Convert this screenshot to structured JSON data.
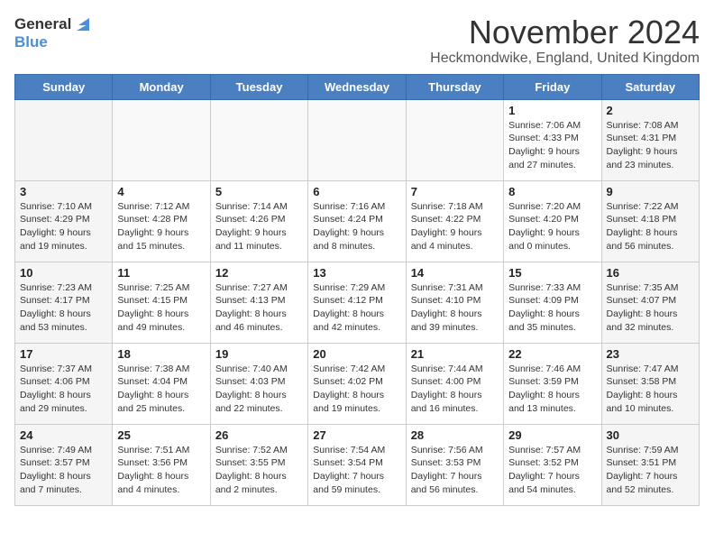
{
  "logo": {
    "line1": "General",
    "line2": "Blue"
  },
  "title": "November 2024",
  "location": "Heckmondwike, England, United Kingdom",
  "weekdays": [
    "Sunday",
    "Monday",
    "Tuesday",
    "Wednesday",
    "Thursday",
    "Friday",
    "Saturday"
  ],
  "weeks": [
    [
      {
        "day": "",
        "info": ""
      },
      {
        "day": "",
        "info": ""
      },
      {
        "day": "",
        "info": ""
      },
      {
        "day": "",
        "info": ""
      },
      {
        "day": "",
        "info": ""
      },
      {
        "day": "1",
        "info": "Sunrise: 7:06 AM\nSunset: 4:33 PM\nDaylight: 9 hours\nand 27 minutes."
      },
      {
        "day": "2",
        "info": "Sunrise: 7:08 AM\nSunset: 4:31 PM\nDaylight: 9 hours\nand 23 minutes."
      }
    ],
    [
      {
        "day": "3",
        "info": "Sunrise: 7:10 AM\nSunset: 4:29 PM\nDaylight: 9 hours\nand 19 minutes."
      },
      {
        "day": "4",
        "info": "Sunrise: 7:12 AM\nSunset: 4:28 PM\nDaylight: 9 hours\nand 15 minutes."
      },
      {
        "day": "5",
        "info": "Sunrise: 7:14 AM\nSunset: 4:26 PM\nDaylight: 9 hours\nand 11 minutes."
      },
      {
        "day": "6",
        "info": "Sunrise: 7:16 AM\nSunset: 4:24 PM\nDaylight: 9 hours\nand 8 minutes."
      },
      {
        "day": "7",
        "info": "Sunrise: 7:18 AM\nSunset: 4:22 PM\nDaylight: 9 hours\nand 4 minutes."
      },
      {
        "day": "8",
        "info": "Sunrise: 7:20 AM\nSunset: 4:20 PM\nDaylight: 9 hours\nand 0 minutes."
      },
      {
        "day": "9",
        "info": "Sunrise: 7:22 AM\nSunset: 4:18 PM\nDaylight: 8 hours\nand 56 minutes."
      }
    ],
    [
      {
        "day": "10",
        "info": "Sunrise: 7:23 AM\nSunset: 4:17 PM\nDaylight: 8 hours\nand 53 minutes."
      },
      {
        "day": "11",
        "info": "Sunrise: 7:25 AM\nSunset: 4:15 PM\nDaylight: 8 hours\nand 49 minutes."
      },
      {
        "day": "12",
        "info": "Sunrise: 7:27 AM\nSunset: 4:13 PM\nDaylight: 8 hours\nand 46 minutes."
      },
      {
        "day": "13",
        "info": "Sunrise: 7:29 AM\nSunset: 4:12 PM\nDaylight: 8 hours\nand 42 minutes."
      },
      {
        "day": "14",
        "info": "Sunrise: 7:31 AM\nSunset: 4:10 PM\nDaylight: 8 hours\nand 39 minutes."
      },
      {
        "day": "15",
        "info": "Sunrise: 7:33 AM\nSunset: 4:09 PM\nDaylight: 8 hours\nand 35 minutes."
      },
      {
        "day": "16",
        "info": "Sunrise: 7:35 AM\nSunset: 4:07 PM\nDaylight: 8 hours\nand 32 minutes."
      }
    ],
    [
      {
        "day": "17",
        "info": "Sunrise: 7:37 AM\nSunset: 4:06 PM\nDaylight: 8 hours\nand 29 minutes."
      },
      {
        "day": "18",
        "info": "Sunrise: 7:38 AM\nSunset: 4:04 PM\nDaylight: 8 hours\nand 25 minutes."
      },
      {
        "day": "19",
        "info": "Sunrise: 7:40 AM\nSunset: 4:03 PM\nDaylight: 8 hours\nand 22 minutes."
      },
      {
        "day": "20",
        "info": "Sunrise: 7:42 AM\nSunset: 4:02 PM\nDaylight: 8 hours\nand 19 minutes."
      },
      {
        "day": "21",
        "info": "Sunrise: 7:44 AM\nSunset: 4:00 PM\nDaylight: 8 hours\nand 16 minutes."
      },
      {
        "day": "22",
        "info": "Sunrise: 7:46 AM\nSunset: 3:59 PM\nDaylight: 8 hours\nand 13 minutes."
      },
      {
        "day": "23",
        "info": "Sunrise: 7:47 AM\nSunset: 3:58 PM\nDaylight: 8 hours\nand 10 minutes."
      }
    ],
    [
      {
        "day": "24",
        "info": "Sunrise: 7:49 AM\nSunset: 3:57 PM\nDaylight: 8 hours\nand 7 minutes."
      },
      {
        "day": "25",
        "info": "Sunrise: 7:51 AM\nSunset: 3:56 PM\nDaylight: 8 hours\nand 4 minutes."
      },
      {
        "day": "26",
        "info": "Sunrise: 7:52 AM\nSunset: 3:55 PM\nDaylight: 8 hours\nand 2 minutes."
      },
      {
        "day": "27",
        "info": "Sunrise: 7:54 AM\nSunset: 3:54 PM\nDaylight: 7 hours\nand 59 minutes."
      },
      {
        "day": "28",
        "info": "Sunrise: 7:56 AM\nSunset: 3:53 PM\nDaylight: 7 hours\nand 56 minutes."
      },
      {
        "day": "29",
        "info": "Sunrise: 7:57 AM\nSunset: 3:52 PM\nDaylight: 7 hours\nand 54 minutes."
      },
      {
        "day": "30",
        "info": "Sunrise: 7:59 AM\nSunset: 3:51 PM\nDaylight: 7 hours\nand 52 minutes."
      }
    ]
  ]
}
